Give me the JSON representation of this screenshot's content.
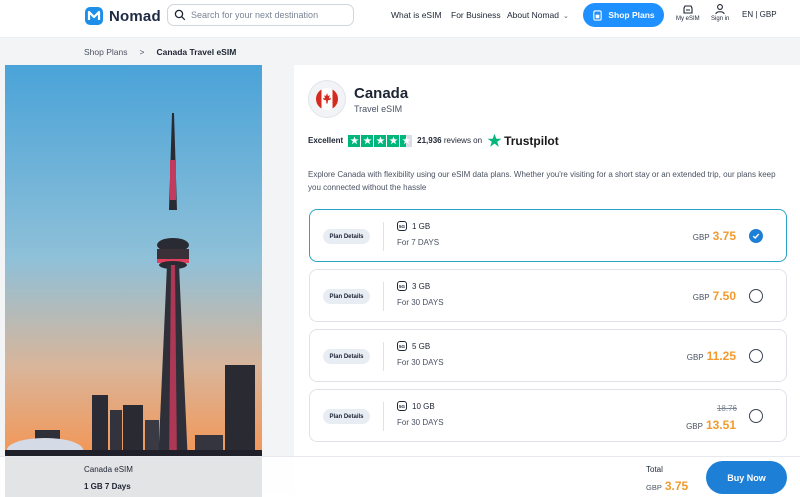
{
  "header": {
    "brand": "Nomad",
    "search_placeholder": "Search for your next destination",
    "nav": {
      "what_is_esim": "What is eSIM",
      "for_business": "For Business",
      "about_nomad": "About Nomad"
    },
    "shop_plans": "Shop Plans",
    "my_esim": "My eSIM",
    "sign_in": "Sign in",
    "language_currency": "EN | GBP"
  },
  "breadcrumb": {
    "parent": "Shop Plans",
    "separator": ">",
    "current": "Canada Travel eSIM"
  },
  "product": {
    "country": "Canada",
    "subtitle": "Travel eSIM",
    "rating_word": "Excellent",
    "review_count": "21,936",
    "reviews_text": "reviews on",
    "trust_brand": "Trustpilot",
    "description": "Explore Canada with flexibility using our eSIM data plans. Whether you're visiting for a short stay or an extended trip, our plans keep you connected without the hassle"
  },
  "plans": [
    {
      "details_label": "Plan Details",
      "data": "1 GB",
      "duration": "For 7 DAYS",
      "currency": "GBP",
      "price": "3.75",
      "old_price": "",
      "selected": true
    },
    {
      "details_label": "Plan Details",
      "data": "3 GB",
      "duration": "For 30 DAYS",
      "currency": "GBP",
      "price": "7.50",
      "old_price": "",
      "selected": false
    },
    {
      "details_label": "Plan Details",
      "data": "5 GB",
      "duration": "For 30 DAYS",
      "currency": "GBP",
      "price": "11.25",
      "old_price": "",
      "selected": false
    },
    {
      "details_label": "Plan Details",
      "data": "10 GB",
      "duration": "For 30 DAYS",
      "currency": "GBP",
      "price": "13.51",
      "old_price": "18.76",
      "selected": false
    }
  ],
  "network_badge": "5G",
  "bottom_bar": {
    "product_name": "Canada eSIM",
    "selected_plan": "1 GB 7 Days",
    "total_label": "Total",
    "currency": "GBP",
    "total": "3.75",
    "buy_label": "Buy Now"
  },
  "colors": {
    "accent": "#1e7fd6",
    "price": "#f29a2e",
    "trustpilot_green": "#00b67a",
    "selected_border": "#2aa3c8"
  }
}
